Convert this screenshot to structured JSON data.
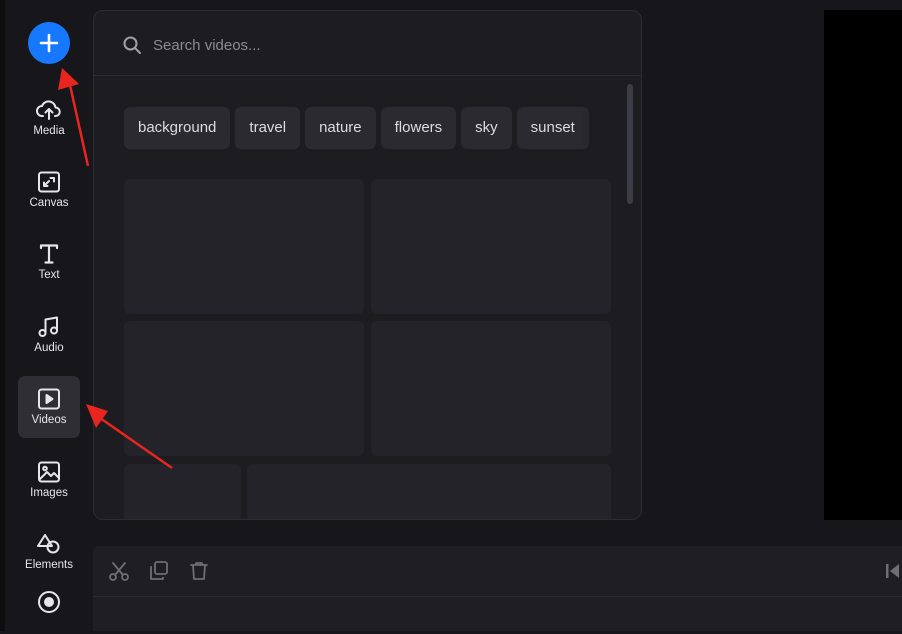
{
  "sidebar": {
    "add_label": "+",
    "items": [
      {
        "id": "media",
        "label": "Media",
        "icon": "cloud-upload-icon"
      },
      {
        "id": "canvas",
        "label": "Canvas",
        "icon": "canvas-resize-icon"
      },
      {
        "id": "text",
        "label": "Text",
        "icon": "text-icon"
      },
      {
        "id": "audio",
        "label": "Audio",
        "icon": "music-note-icon"
      },
      {
        "id": "videos",
        "label": "Videos",
        "icon": "video-play-icon",
        "active": true
      },
      {
        "id": "images",
        "label": "Images",
        "icon": "image-icon"
      },
      {
        "id": "elements",
        "label": "Elements",
        "icon": "shapes-icon"
      },
      {
        "id": "record",
        "label": "",
        "icon": "record-icon"
      }
    ]
  },
  "panel": {
    "search": {
      "placeholder": "Search videos...",
      "value": ""
    },
    "chips": [
      "background",
      "travel",
      "nature",
      "flowers",
      "sky",
      "sunset"
    ]
  },
  "timeline": {
    "tools": [
      "scissors-icon",
      "duplicate-icon",
      "trash-icon",
      "skip-back-icon"
    ]
  },
  "colors": {
    "accent": "#1677ff",
    "annotation": "#e8251f",
    "background": "#17171b",
    "panel": "#1c1c21"
  }
}
